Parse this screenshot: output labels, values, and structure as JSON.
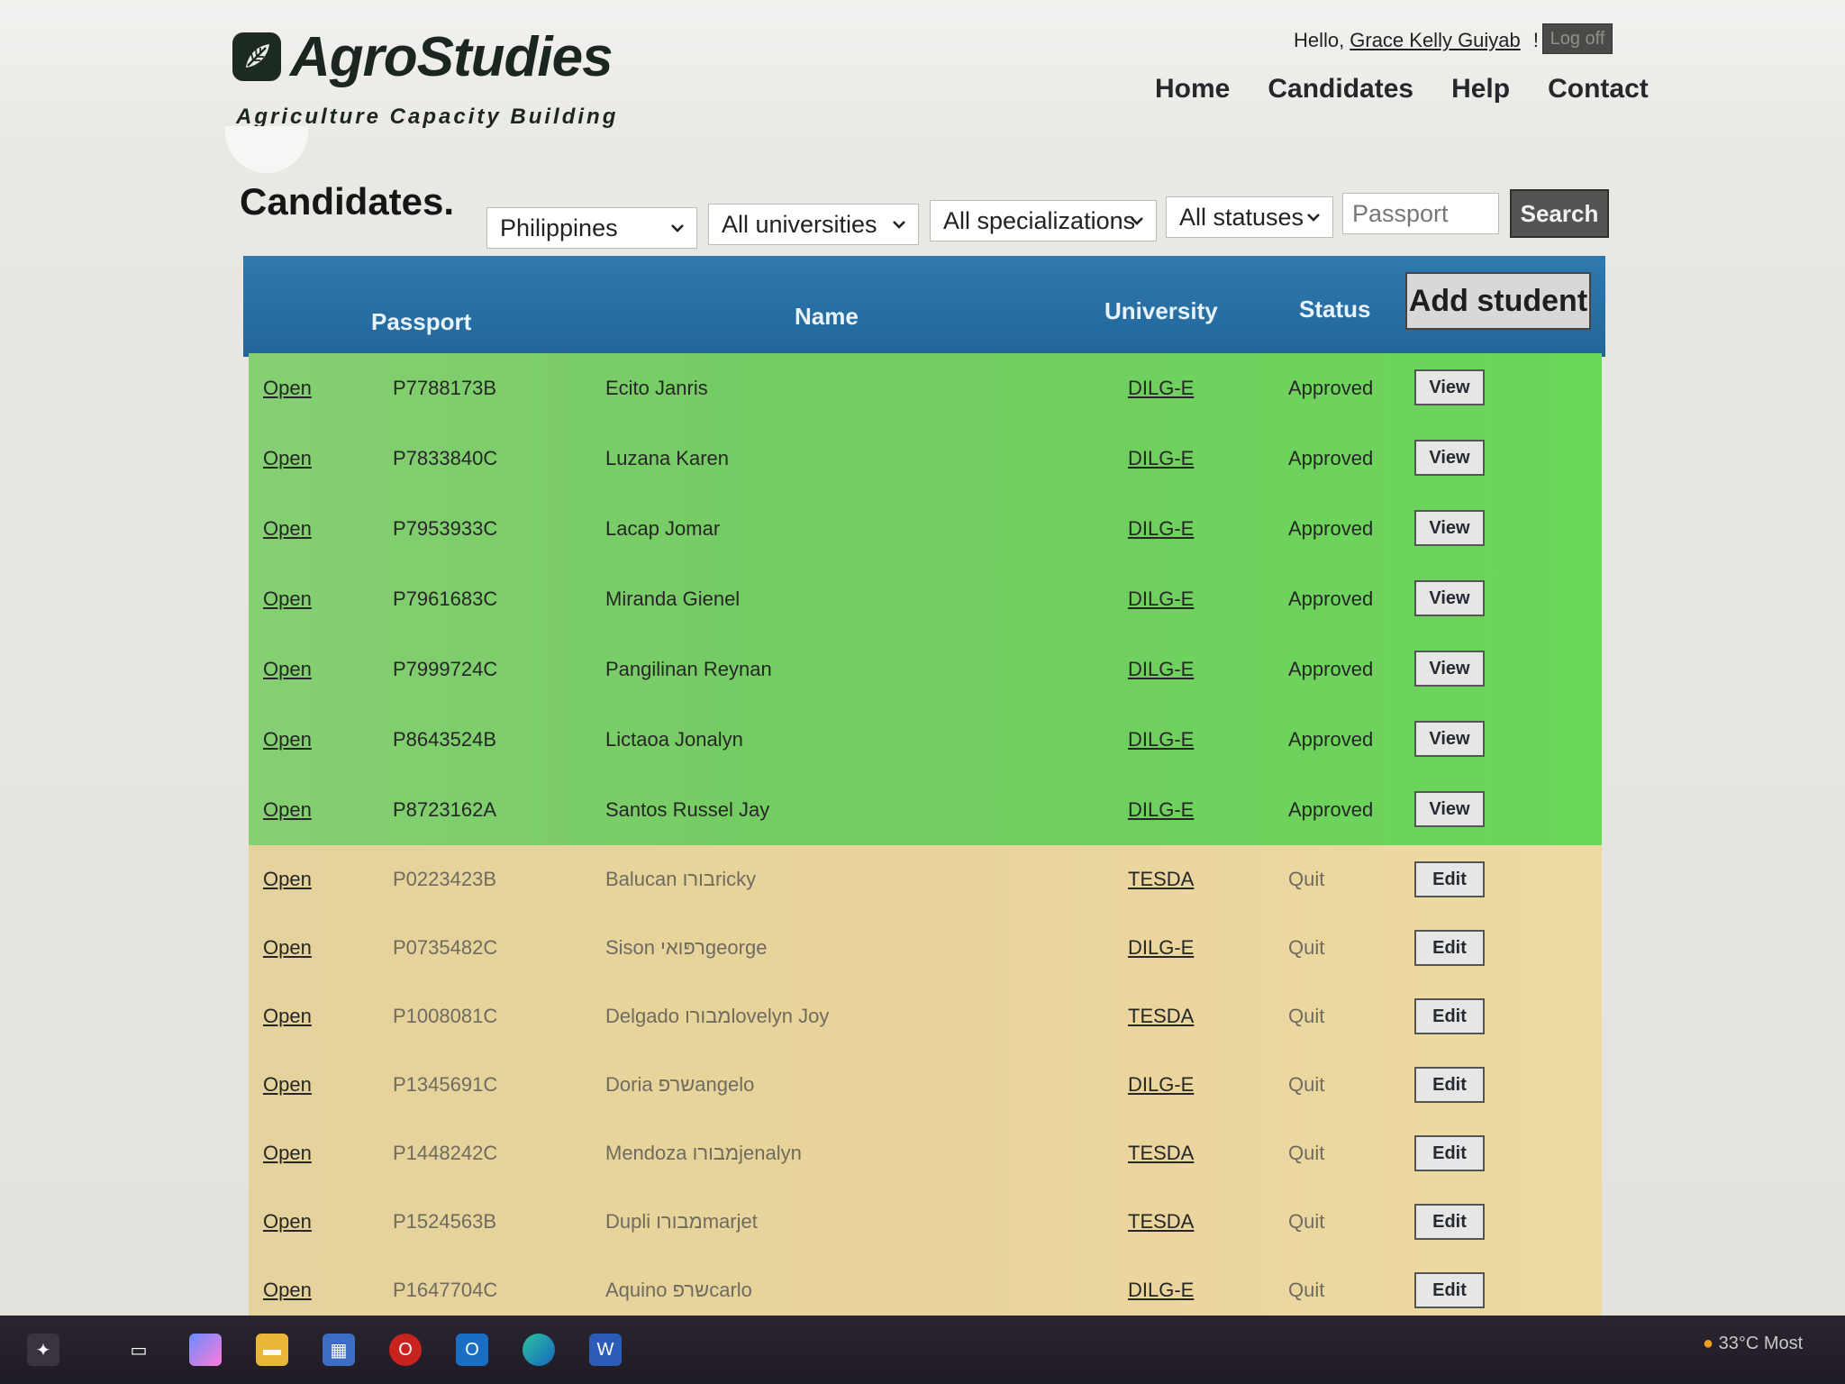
{
  "header": {
    "brand_name": "AgroStudies",
    "brand_tagline": "Agriculture Capacity Building",
    "greeting_prefix": "Hello,",
    "user_name": "Grace Kelly Guiyab",
    "greeting_suffix": "!",
    "logoff_label": "Log off",
    "nav": [
      "Home",
      "Candidates",
      "Help",
      "Contact"
    ]
  },
  "page_title": "Candidates.",
  "filters": {
    "country": "Philippines",
    "university": "All universities",
    "specialization": "All specializations",
    "status": "All statuses",
    "passport_placeholder": "Passport",
    "search_label": "Search"
  },
  "table": {
    "headers": {
      "passport": "Passport",
      "name": "Name",
      "university": "University",
      "status": "Status"
    },
    "add_student_label": "Add student",
    "open_label": "Open",
    "rows": [
      {
        "passport": "P7788173B",
        "name": "Ecito Janris",
        "university": "DILG-E",
        "status": "Approved",
        "action": "View"
      },
      {
        "passport": "P7833840C",
        "name": "Luzana Karen",
        "university": "DILG-E",
        "status": "Approved",
        "action": "View"
      },
      {
        "passport": "P7953933C",
        "name": "Lacap Jomar",
        "university": "DILG-E",
        "status": "Approved",
        "action": "View"
      },
      {
        "passport": "P7961683C",
        "name": "Miranda Gienel",
        "university": "DILG-E",
        "status": "Approved",
        "action": "View"
      },
      {
        "passport": "P7999724C",
        "name": "Pangilinan Reynan",
        "university": "DILG-E",
        "status": "Approved",
        "action": "View"
      },
      {
        "passport": "P8643524B",
        "name": "Lictaoa Jonalyn",
        "university": "DILG-E",
        "status": "Approved",
        "action": "View"
      },
      {
        "passport": "P8723162A",
        "name": "Santos Russel Jay",
        "university": "DILG-E",
        "status": "Approved",
        "action": "View"
      },
      {
        "passport": "P0223423B",
        "name": "Balucan בורוricky",
        "university": "TESDA",
        "status": "Quit",
        "action": "Edit"
      },
      {
        "passport": "P0735482C",
        "name": "Sison רפּואיgeorge",
        "university": "DILG-E",
        "status": "Quit",
        "action": "Edit"
      },
      {
        "passport": "P1008081C",
        "name": "Delgado מבורוlovelyn Joy",
        "university": "TESDA",
        "status": "Quit",
        "action": "Edit"
      },
      {
        "passport": "P1345691C",
        "name": "Doria שרפangelo",
        "university": "DILG-E",
        "status": "Quit",
        "action": "Edit"
      },
      {
        "passport": "P1448242C",
        "name": "Mendoza מבורוjenalyn",
        "university": "TESDA",
        "status": "Quit",
        "action": "Edit"
      },
      {
        "passport": "P1524563B",
        "name": "Dupli מבורוmarjet",
        "university": "TESDA",
        "status": "Quit",
        "action": "Edit"
      },
      {
        "passport": "P1647704C",
        "name": "Aquino שרפcarlo",
        "university": "DILG-E",
        "status": "Quit",
        "action": "Edit"
      }
    ]
  },
  "taskbar": {
    "weather": "33°C Most"
  },
  "colors": {
    "table_header": "#2f79ae",
    "approved_row": "#74cc62",
    "quit_row": "#e8d49a",
    "search_button": "#535552"
  }
}
